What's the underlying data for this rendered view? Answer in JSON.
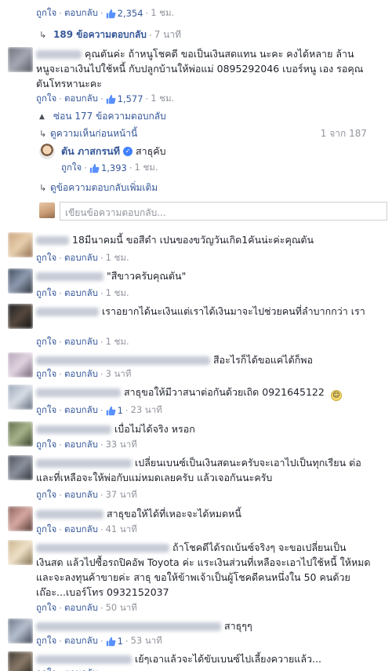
{
  "actions": {
    "like": "ถูกใจ",
    "reply": "ตอบกลับ"
  },
  "colors": {
    "link": "#365899",
    "meta": "#90949c",
    "verified": "#4080ff"
  },
  "top": {
    "likes": "2,354",
    "time": "1 ชม."
  },
  "top_replies": {
    "label": "189 ข้อความตอบกลับ",
    "time": "7 นาที"
  },
  "comment1": {
    "text": "คุณตันค่ะ ถ้าหนูโชคดี ขอเป็นเงินสดแทน นะคะ คงได้หลาย ล้าน หนูจะเอาเงินไปใช้หนี้ กับปลูกบ้านให้พ่อแม่ 0895292046 เบอร์หนู เอง รอคุณตันโทรหานะคะ",
    "likes": "1,577",
    "time": "1 ชม."
  },
  "hide_replies": "ซ่อน 177 ข้อความตอบกลับ",
  "previous": {
    "label": "ดูความเห็นก่อนหน้านี้",
    "count": "1 จาก 187"
  },
  "reply_tan": {
    "name": "ตัน ภาสกรนที",
    "text": "สาธุคับ",
    "likes": "1,393",
    "time": "1 ชม."
  },
  "more_replies": "ดูข้อความตอบกลับเพิ่มเติม",
  "reply_input": {
    "placeholder": "เขียนข้อความตอบกลับ..."
  },
  "comments": [
    {
      "text": "18มีนาคมนี้ ขอสีดำ เปนของขวัญวันเกิด1คันน่ะค่ะคุณตัน",
      "time": "1 ชม."
    },
    {
      "text": "\"สีขาวครับคุณตัน\"",
      "time": "1 ชม."
    },
    {
      "text": "เราอยากได้นะเงินแต่เราได้เงินมาจะไปช่วยคนที่ลำบากกว่า เรา",
      "time": "1 ชม."
    },
    {
      "text": "สีอะไรก็ได้ขอแค่ได้ก็พอ",
      "time": "3 นาที"
    },
    {
      "text": "สาธุขอให้มีวาสนาต่อกันด้วยเถิด 0921645122",
      "likes": "1",
      "time": "23 นาที"
    },
    {
      "text": "เบื่อไม่ได้จริง หรอก",
      "time": "33 นาที"
    },
    {
      "text": "เปลี่ยนเบนซ์เป็นเงินสดนะครับจะเอาไปเป็นทุกเรียน ต่อ และที่เหลือจะให้พ่อกับแม่หมดเลยครับ แล้วเจอกันนะครับ",
      "time": "37 นาที"
    },
    {
      "text": "สาธุขอให้ได้ที่เหอะจะได้หมดหนี้",
      "time": "41 นาที"
    },
    {
      "text": "ถ้าโชคดีได้รถเบ้นซ์จริงๆ จะขอเปลี่ยนเป็น เงินสด แล้วไปซื้อรถปิคอัพ Toyota ค่ะ แระเงินส่วนที่เหลือจะเอาไปใช้หนี้ ให้หมด และจะลงทุนค้าขายค่ะ สาธุ ขอให้ข้าพเจ้าเป็นผู้โชคดีคนหนึ่งใน 50 คนด้วยเถ๊อะ...เบอร์โทร 0932152037",
      "time": "50 นาที"
    },
    {
      "text": "สาธุๆๆ",
      "likes": "1",
      "time": "53 นาที"
    },
    {
      "text": "เย้ๆเอาแล้วจะได้ขับเบนซ์ไปเลี้ยงควายแล้ว..."
    }
  ]
}
